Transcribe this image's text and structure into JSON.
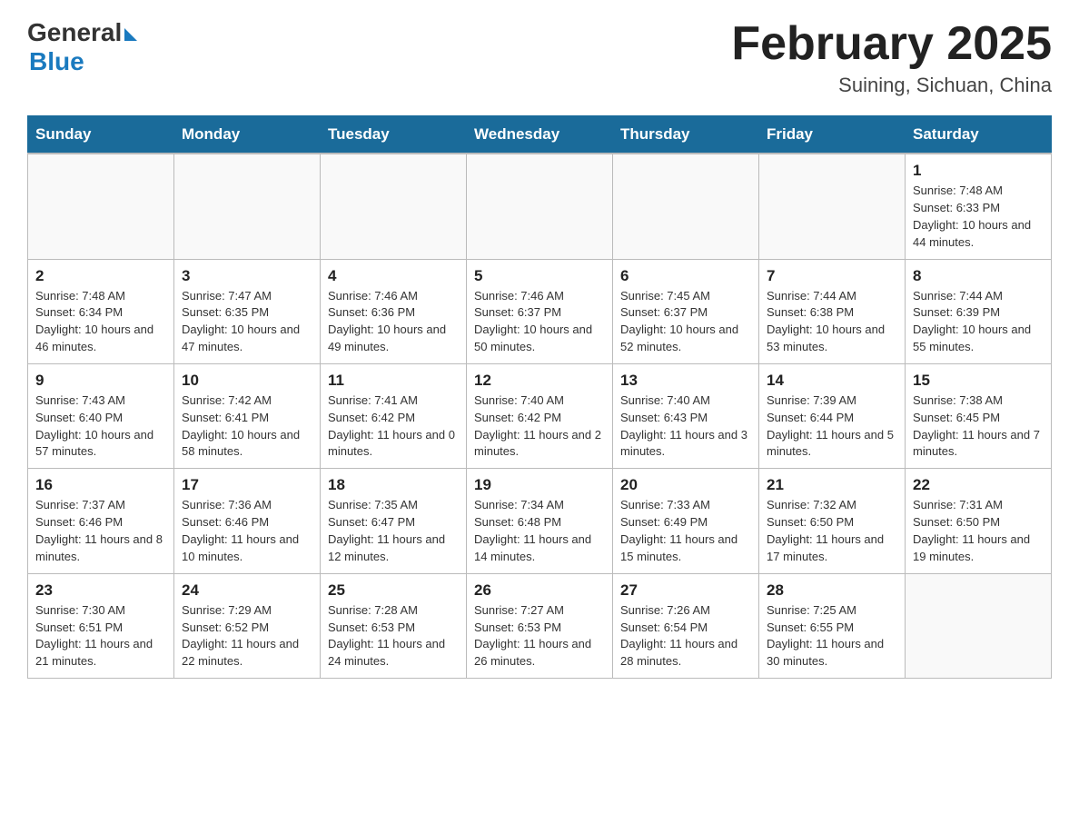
{
  "header": {
    "logo_general": "General",
    "logo_blue": "Blue",
    "title": "February 2025",
    "location": "Suining, Sichuan, China"
  },
  "days_of_week": [
    "Sunday",
    "Monday",
    "Tuesday",
    "Wednesday",
    "Thursday",
    "Friday",
    "Saturday"
  ],
  "weeks": [
    [
      {
        "day": "",
        "sunrise": "",
        "sunset": "",
        "daylight": ""
      },
      {
        "day": "",
        "sunrise": "",
        "sunset": "",
        "daylight": ""
      },
      {
        "day": "",
        "sunrise": "",
        "sunset": "",
        "daylight": ""
      },
      {
        "day": "",
        "sunrise": "",
        "sunset": "",
        "daylight": ""
      },
      {
        "day": "",
        "sunrise": "",
        "sunset": "",
        "daylight": ""
      },
      {
        "day": "",
        "sunrise": "",
        "sunset": "",
        "daylight": ""
      },
      {
        "day": "1",
        "sunrise": "Sunrise: 7:48 AM",
        "sunset": "Sunset: 6:33 PM",
        "daylight": "Daylight: 10 hours and 44 minutes."
      }
    ],
    [
      {
        "day": "2",
        "sunrise": "Sunrise: 7:48 AM",
        "sunset": "Sunset: 6:34 PM",
        "daylight": "Daylight: 10 hours and 46 minutes."
      },
      {
        "day": "3",
        "sunrise": "Sunrise: 7:47 AM",
        "sunset": "Sunset: 6:35 PM",
        "daylight": "Daylight: 10 hours and 47 minutes."
      },
      {
        "day": "4",
        "sunrise": "Sunrise: 7:46 AM",
        "sunset": "Sunset: 6:36 PM",
        "daylight": "Daylight: 10 hours and 49 minutes."
      },
      {
        "day": "5",
        "sunrise": "Sunrise: 7:46 AM",
        "sunset": "Sunset: 6:37 PM",
        "daylight": "Daylight: 10 hours and 50 minutes."
      },
      {
        "day": "6",
        "sunrise": "Sunrise: 7:45 AM",
        "sunset": "Sunset: 6:37 PM",
        "daylight": "Daylight: 10 hours and 52 minutes."
      },
      {
        "day": "7",
        "sunrise": "Sunrise: 7:44 AM",
        "sunset": "Sunset: 6:38 PM",
        "daylight": "Daylight: 10 hours and 53 minutes."
      },
      {
        "day": "8",
        "sunrise": "Sunrise: 7:44 AM",
        "sunset": "Sunset: 6:39 PM",
        "daylight": "Daylight: 10 hours and 55 minutes."
      }
    ],
    [
      {
        "day": "9",
        "sunrise": "Sunrise: 7:43 AM",
        "sunset": "Sunset: 6:40 PM",
        "daylight": "Daylight: 10 hours and 57 minutes."
      },
      {
        "day": "10",
        "sunrise": "Sunrise: 7:42 AM",
        "sunset": "Sunset: 6:41 PM",
        "daylight": "Daylight: 10 hours and 58 minutes."
      },
      {
        "day": "11",
        "sunrise": "Sunrise: 7:41 AM",
        "sunset": "Sunset: 6:42 PM",
        "daylight": "Daylight: 11 hours and 0 minutes."
      },
      {
        "day": "12",
        "sunrise": "Sunrise: 7:40 AM",
        "sunset": "Sunset: 6:42 PM",
        "daylight": "Daylight: 11 hours and 2 minutes."
      },
      {
        "day": "13",
        "sunrise": "Sunrise: 7:40 AM",
        "sunset": "Sunset: 6:43 PM",
        "daylight": "Daylight: 11 hours and 3 minutes."
      },
      {
        "day": "14",
        "sunrise": "Sunrise: 7:39 AM",
        "sunset": "Sunset: 6:44 PM",
        "daylight": "Daylight: 11 hours and 5 minutes."
      },
      {
        "day": "15",
        "sunrise": "Sunrise: 7:38 AM",
        "sunset": "Sunset: 6:45 PM",
        "daylight": "Daylight: 11 hours and 7 minutes."
      }
    ],
    [
      {
        "day": "16",
        "sunrise": "Sunrise: 7:37 AM",
        "sunset": "Sunset: 6:46 PM",
        "daylight": "Daylight: 11 hours and 8 minutes."
      },
      {
        "day": "17",
        "sunrise": "Sunrise: 7:36 AM",
        "sunset": "Sunset: 6:46 PM",
        "daylight": "Daylight: 11 hours and 10 minutes."
      },
      {
        "day": "18",
        "sunrise": "Sunrise: 7:35 AM",
        "sunset": "Sunset: 6:47 PM",
        "daylight": "Daylight: 11 hours and 12 minutes."
      },
      {
        "day": "19",
        "sunrise": "Sunrise: 7:34 AM",
        "sunset": "Sunset: 6:48 PM",
        "daylight": "Daylight: 11 hours and 14 minutes."
      },
      {
        "day": "20",
        "sunrise": "Sunrise: 7:33 AM",
        "sunset": "Sunset: 6:49 PM",
        "daylight": "Daylight: 11 hours and 15 minutes."
      },
      {
        "day": "21",
        "sunrise": "Sunrise: 7:32 AM",
        "sunset": "Sunset: 6:50 PM",
        "daylight": "Daylight: 11 hours and 17 minutes."
      },
      {
        "day": "22",
        "sunrise": "Sunrise: 7:31 AM",
        "sunset": "Sunset: 6:50 PM",
        "daylight": "Daylight: 11 hours and 19 minutes."
      }
    ],
    [
      {
        "day": "23",
        "sunrise": "Sunrise: 7:30 AM",
        "sunset": "Sunset: 6:51 PM",
        "daylight": "Daylight: 11 hours and 21 minutes."
      },
      {
        "day": "24",
        "sunrise": "Sunrise: 7:29 AM",
        "sunset": "Sunset: 6:52 PM",
        "daylight": "Daylight: 11 hours and 22 minutes."
      },
      {
        "day": "25",
        "sunrise": "Sunrise: 7:28 AM",
        "sunset": "Sunset: 6:53 PM",
        "daylight": "Daylight: 11 hours and 24 minutes."
      },
      {
        "day": "26",
        "sunrise": "Sunrise: 7:27 AM",
        "sunset": "Sunset: 6:53 PM",
        "daylight": "Daylight: 11 hours and 26 minutes."
      },
      {
        "day": "27",
        "sunrise": "Sunrise: 7:26 AM",
        "sunset": "Sunset: 6:54 PM",
        "daylight": "Daylight: 11 hours and 28 minutes."
      },
      {
        "day": "28",
        "sunrise": "Sunrise: 7:25 AM",
        "sunset": "Sunset: 6:55 PM",
        "daylight": "Daylight: 11 hours and 30 minutes."
      },
      {
        "day": "",
        "sunrise": "",
        "sunset": "",
        "daylight": ""
      }
    ]
  ]
}
